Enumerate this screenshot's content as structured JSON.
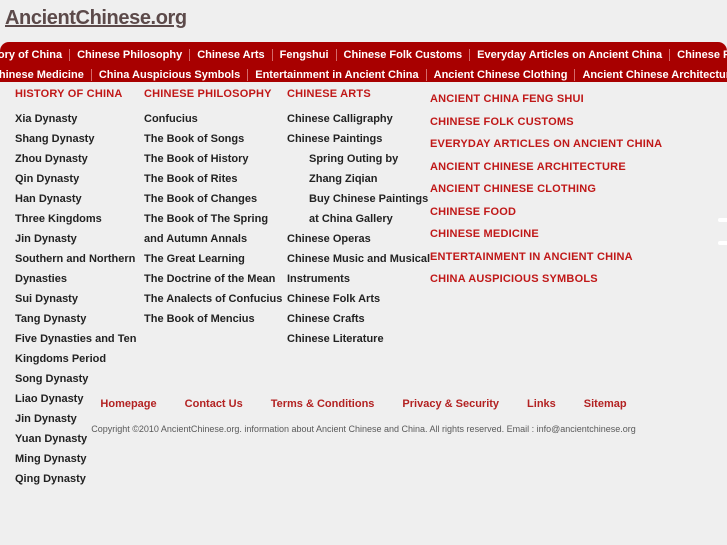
{
  "site": {
    "logo_text": "AncientChinese.org"
  },
  "nav": {
    "row1": [
      "History of China",
      "Chinese Philosophy",
      "Chinese Arts",
      "Fengshui",
      "Chinese Folk Customs",
      "Everyday Articles on Ancient China",
      "Chinese Food"
    ],
    "row2": [
      "Chinese Medicine",
      "China Auspicious Symbols",
      "Entertainment in Ancient China",
      "Ancient Chinese Clothing",
      "Ancient Chinese Architecture"
    ]
  },
  "sitemap": {
    "history": {
      "heading": "HISTORY OF CHINA",
      "items": [
        "Xia Dynasty",
        "Shang Dynasty",
        "Zhou Dynasty",
        "Qin Dynasty",
        "Han Dynasty",
        "Three Kingdoms",
        "Jin Dynasty",
        "Southern and Northern",
        "Dynasties",
        "Sui Dynasty",
        "Tang Dynasty",
        "Five Dynasties and Ten",
        "Kingdoms Period",
        "Song Dynasty",
        "Liao Dynasty",
        "Jin Dynasty",
        "Yuan Dynasty",
        "Ming Dynasty",
        "Qing Dynasty"
      ]
    },
    "philosophy": {
      "heading": "CHINESE PHILOSOPHY",
      "items": [
        "Confucius",
        "The Book of Songs",
        "The Book of History",
        "The Book of Rites",
        "The Book of Changes",
        "The Book of The Spring",
        "and Autumn Annals",
        "The Great Learning",
        "The Doctrine of the Mean",
        "The Analects of Confucius",
        "The Book of Mencius"
      ]
    },
    "arts": {
      "heading": "CHINESE ARTS",
      "items": [
        {
          "label": "Chinese Calligraphy",
          "indent": false
        },
        {
          "label": "Chinese Paintings",
          "indent": false
        },
        {
          "label": "Spring Outing by",
          "indent": true
        },
        {
          "label": "Zhang Ziqian",
          "indent": true
        },
        {
          "label": "Buy Chinese Paintings",
          "indent": true
        },
        {
          "label": "at China Gallery",
          "indent": true
        },
        {
          "label": "Chinese Operas",
          "indent": false
        },
        {
          "label": "Chinese Music and Musical",
          "indent": false
        },
        {
          "label": "Instruments",
          "indent": false
        },
        {
          "label": "Chinese Folk Arts",
          "indent": false
        },
        {
          "label": "Chinese Crafts",
          "indent": false
        },
        {
          "label": "Chinese Literature",
          "indent": false
        }
      ]
    },
    "sections": [
      "ANCIENT CHINA FENG SHUI",
      "CHINESE FOLK CUSTOMS",
      "EVERYDAY ARTICLES ON ANCIENT CHINA",
      "ANCIENT CHINESE ARCHITECTURE",
      "ANCIENT CHINESE CLOTHING",
      "CHINESE FOOD",
      "CHINESE MEDICINE",
      "ENTERTAINMENT IN ANCIENT CHINA",
      "CHINA AUSPICIOUS SYMBOLS"
    ]
  },
  "footer": {
    "links": [
      "Homepage",
      "Contact Us",
      "Terms & Conditions",
      "Privacy & Security",
      "Links",
      "Sitemap"
    ],
    "copyright": "Copyright ©2010 AncientChinese.org. information about Ancient Chinese and China. All rights reserved. Email : info@ancientchinese.org"
  },
  "colors": {
    "nav_background": "#a80000",
    "heading_red": "#c01818",
    "footer_link_red": "#b32222",
    "page_background": "#efefef",
    "logo_text": "#5c4a4a"
  }
}
